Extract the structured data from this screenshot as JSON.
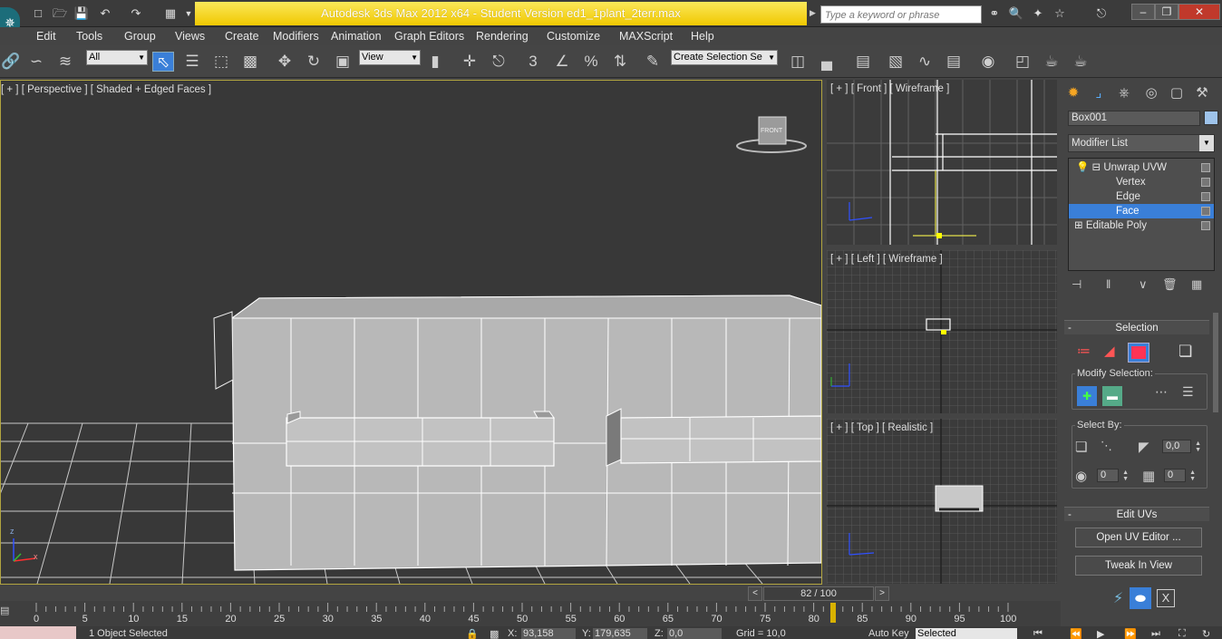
{
  "app": {
    "title": "Autodesk 3ds Max  2012 x64   -  Student Version    ed1_1plant_2terr.max",
    "logo": "3ds-max-logo-icon",
    "search_placeholder": "Type a keyword or phrase"
  },
  "menu": [
    "Edit",
    "Tools",
    "Group",
    "Views",
    "Create",
    "Modifiers",
    "Animation",
    "Graph Editors",
    "Rendering",
    "Customize",
    "MAXScript",
    "Help"
  ],
  "toolbar": {
    "filter_value": "All",
    "ref_coord": "View",
    "selection_set": "Create Selection Se",
    "snap_3": "3",
    "snap_pct": "%"
  },
  "viewports": {
    "perspective": "[ + ] [ Perspective ] [ Shaded + Edged Faces ]",
    "front": "[ + ] [ Front ] [ Wireframe ]",
    "left": "[ + ] [ Left ] [ Wireframe ]",
    "top": "[ + ] [ Top ] [ Realistic ]",
    "viewcube": "FRONT",
    "axis": {
      "x": "x",
      "y": "y",
      "z": "z"
    }
  },
  "command_panel": {
    "object_name": "Box001",
    "modifier_list": "Modifier List",
    "stack": [
      {
        "label": "Unwrap UVW",
        "selected": false
      },
      {
        "label": "Vertex",
        "selected": false
      },
      {
        "label": "Edge",
        "selected": false
      },
      {
        "label": "Face",
        "selected": true
      },
      {
        "label": "Editable Poly",
        "selected": false
      }
    ],
    "selection_rollout": "Selection",
    "modify_selection": "Modify Selection:",
    "select_by": "Select By:",
    "spinner_angle": "0,0",
    "spinner_a": "0",
    "spinner_b": "0",
    "edit_uvs_rollout": "Edit UVs",
    "open_uv_editor": "Open UV Editor ...",
    "tweak_in_view": "Tweak In View",
    "x_button": "X"
  },
  "timeline": {
    "frame": "82 / 100",
    "prev": "<",
    "next": ">",
    "ticks": [
      "0",
      "5",
      "10",
      "15",
      "20",
      "25",
      "30",
      "35",
      "40",
      "45",
      "50",
      "55",
      "60",
      "65",
      "70",
      "75",
      "80",
      "85",
      "90",
      "95",
      "100"
    ],
    "current": 82,
    "total": 100
  },
  "status": {
    "selected": "1 Object Selected",
    "x_label": "X:",
    "x_val": "93,158",
    "y_label": "Y:",
    "y_val": "179,635",
    "z_label": "Z:",
    "z_val": "0,0",
    "grid": "Grid = 10,0",
    "autokey": "Auto Key",
    "selected_dropdown": "Selected"
  },
  "colors": {
    "title_bg": "#f5d20a",
    "selection": "#3a7fd8",
    "viewport_border": "#b2a540"
  }
}
